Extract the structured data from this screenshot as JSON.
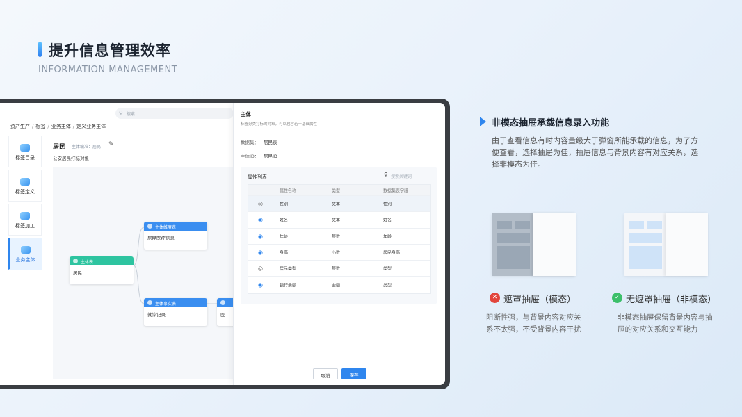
{
  "header": {
    "title": "提升信息管理效率",
    "subtitle": "INFORMATION MANAGEMENT"
  },
  "app": {
    "search_placeholder": "搜索",
    "breadcrumb": [
      "资产生产",
      "标签",
      "业务主体",
      "定义业务主体"
    ],
    "breadcrumb_sep": "/",
    "sidebar": [
      {
        "label": "标签目录",
        "icon": "folder-icon"
      },
      {
        "label": "标签定义",
        "icon": "tag-icon"
      },
      {
        "label": "标签加工",
        "icon": "process-icon"
      },
      {
        "label": "业务主体",
        "icon": "cube-icon",
        "active": true
      }
    ],
    "entity": {
      "name": "居民",
      "tag": "主体编准：居民",
      "desc": "公安居民打标对象"
    },
    "nodes": [
      {
        "header": "主体表",
        "body": "居民",
        "color": "#2ec4a0"
      },
      {
        "header": "主体维度表",
        "body": "居民医疗信息",
        "color": "#3a8ef0"
      },
      {
        "header": "主体事实表",
        "body": "就诊记录",
        "color": "#3a8ef0"
      },
      {
        "body": "医"
      }
    ],
    "drawer": {
      "title": "主体",
      "desc": "标签分类打标的对象，可以包含若干基础属性",
      "dataset_label": "数据集：",
      "dataset_value": "居民表",
      "id_label": "主体ID：",
      "id_value": "居民ID",
      "attr_title": "属性列表",
      "attr_search_placeholder": "搜索关键词",
      "columns": [
        "属性名称",
        "类型",
        "数据集表字段"
      ],
      "rows": [
        {
          "visible": false,
          "name": "性别",
          "type": "文本",
          "field": "性别"
        },
        {
          "visible": true,
          "name": "姓名",
          "type": "文本",
          "field": "姓名"
        },
        {
          "visible": true,
          "name": "年龄",
          "type": "整数",
          "field": "年龄"
        },
        {
          "visible": true,
          "name": "身高",
          "type": "小数",
          "field": "居民身高"
        },
        {
          "visible": false,
          "name": "居民类型",
          "type": "整数",
          "field": "类型"
        },
        {
          "visible": true,
          "name": "银行余额",
          "type": "金额",
          "field": "类型"
        }
      ],
      "cancel": "取消",
      "save": "保存"
    }
  },
  "feature": {
    "title": "非模态抽屉承载信息录入功能",
    "desc": "由于查看信息有时内容量级大于弹窗所能承载的信息，为了方便查看，选择抽屉为佳，抽屉信息与背景内容有对应关系，选择非模态为佳。",
    "modal": {
      "caption": "遮罩抽屉（模态）",
      "desc": "阻断性强，与背景内容对应关系不太强，不受背景内容干扰",
      "icon": "x-icon",
      "color": "#e2453c"
    },
    "nonmodal": {
      "caption": "无遮罩抽屉（非模态）",
      "desc": "非模态抽屉保留背景内容与抽屉的对应关系和交互能力",
      "icon": "check-icon",
      "color": "#3cbf6a"
    }
  }
}
